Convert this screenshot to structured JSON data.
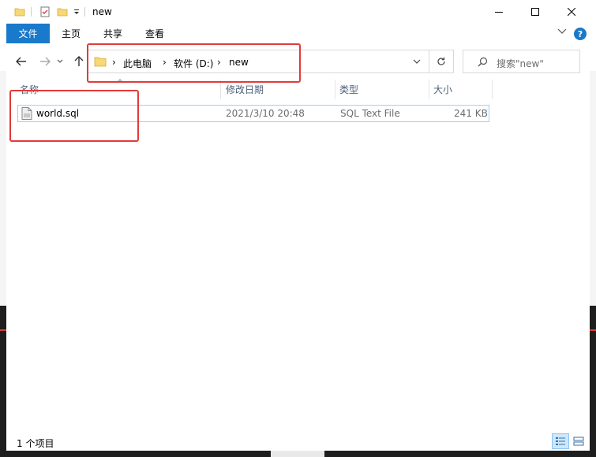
{
  "window": {
    "title": "new"
  },
  "ribbon": {
    "tabs": [
      {
        "label": "文件",
        "active": true
      },
      {
        "label": "主页"
      },
      {
        "label": "共享"
      },
      {
        "label": "查看"
      }
    ],
    "help_label": "?"
  },
  "address_bar": {
    "crumbs": [
      "此电脑",
      "软件 (D:)",
      "new"
    ]
  },
  "search": {
    "placeholder": "搜索\"new\""
  },
  "columns": [
    {
      "label": "名称"
    },
    {
      "label": "修改日期"
    },
    {
      "label": "类型"
    },
    {
      "label": "大小"
    }
  ],
  "files": [
    {
      "name": "world.sql",
      "modified": "2021/3/10 20:48",
      "type": "SQL Text File",
      "size": "241 KB"
    }
  ],
  "status_bar": {
    "item_count": "1 个项目"
  },
  "colors": {
    "accent": "#1979ca",
    "annotation": "#e23a3a",
    "header_text": "#4c607a",
    "folder": "#f8d775"
  },
  "icons": [
    "folder-icon",
    "properties-icon",
    "back-arrow-icon",
    "forward-arrow-icon",
    "recent-dropdown-icon",
    "up-arrow-icon",
    "refresh-icon",
    "search-icon",
    "sql-file-icon",
    "details-view-icon",
    "large-icons-view-icon"
  ]
}
